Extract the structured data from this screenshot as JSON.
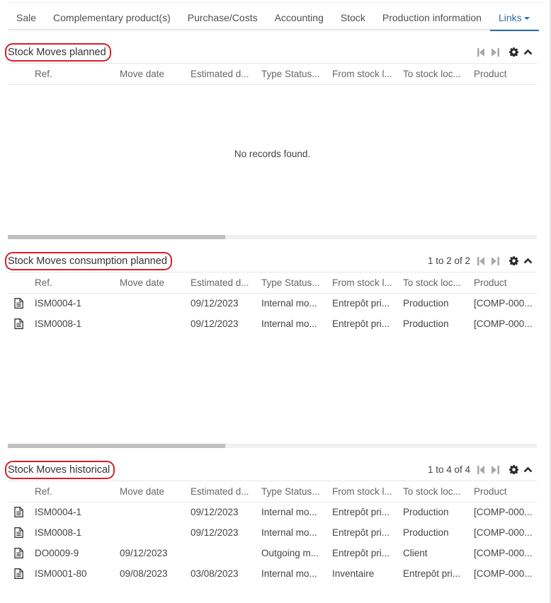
{
  "tabs": [
    {
      "label": "Sale",
      "active": false
    },
    {
      "label": "Complementary product(s)",
      "active": false
    },
    {
      "label": "Purchase/Costs",
      "active": false
    },
    {
      "label": "Accounting",
      "active": false
    },
    {
      "label": "Stock",
      "active": false
    },
    {
      "label": "Production information",
      "active": false
    },
    {
      "label": "Links",
      "active": true,
      "dropdown": true
    }
  ],
  "columns": [
    "Ref.",
    "Move date",
    "Estimated d...",
    "Type Status...",
    "From stock l...",
    "To stock loc...",
    "Product"
  ],
  "panels": {
    "planned": {
      "title": "Stock Moves planned",
      "pager": "",
      "empty_message": "No records found.",
      "rows": []
    },
    "consumption": {
      "title": "Stock Moves consumption planned",
      "pager": "1 to 2 of 2",
      "rows": [
        {
          "ref": "ISM0004-1",
          "move_date": "",
          "estimated_date": "09/12/2023",
          "type_status": "Internal mo...",
          "from": "Entrepôt pri...",
          "to": "Production",
          "product": "[COMP-000..."
        },
        {
          "ref": "ISM0008-1",
          "move_date": "",
          "estimated_date": "09/12/2023",
          "type_status": "Internal mo...",
          "from": "Entrepôt pri...",
          "to": "Production",
          "product": "[COMP-000..."
        }
      ]
    },
    "historical": {
      "title": "Stock Moves historical",
      "pager": "1 to 4 of 4",
      "rows": [
        {
          "ref": "ISM0004-1",
          "move_date": "",
          "estimated_date": "09/12/2023",
          "type_status": "Internal mo...",
          "from": "Entrepôt pri...",
          "to": "Production",
          "product": "[COMP-000..."
        },
        {
          "ref": "ISM0008-1",
          "move_date": "",
          "estimated_date": "09/12/2023",
          "type_status": "Internal mo...",
          "from": "Entrepôt pri...",
          "to": "Production",
          "product": "[COMP-000..."
        },
        {
          "ref": "DO0009-9",
          "move_date": "09/12/2023",
          "estimated_date": "",
          "type_status": "Outgoing m...",
          "from": "Entrepôt pri...",
          "to": "Client",
          "product": "[COMP-000..."
        },
        {
          "ref": "ISM0001-80",
          "move_date": "09/08/2023",
          "estimated_date": "03/08/2023",
          "type_status": "Internal mo...",
          "from": "Inventaire",
          "to": "Entrepôt pri...",
          "product": "[COMP-000..."
        }
      ]
    }
  },
  "icons": {
    "row": "document-icon",
    "first": "first-page-icon",
    "last": "last-page-icon",
    "settings": "gear-icon",
    "collapse": "chevron-up-icon"
  },
  "colors": {
    "accent": "#2e6da4",
    "highlight_outline": "#d9202a"
  }
}
